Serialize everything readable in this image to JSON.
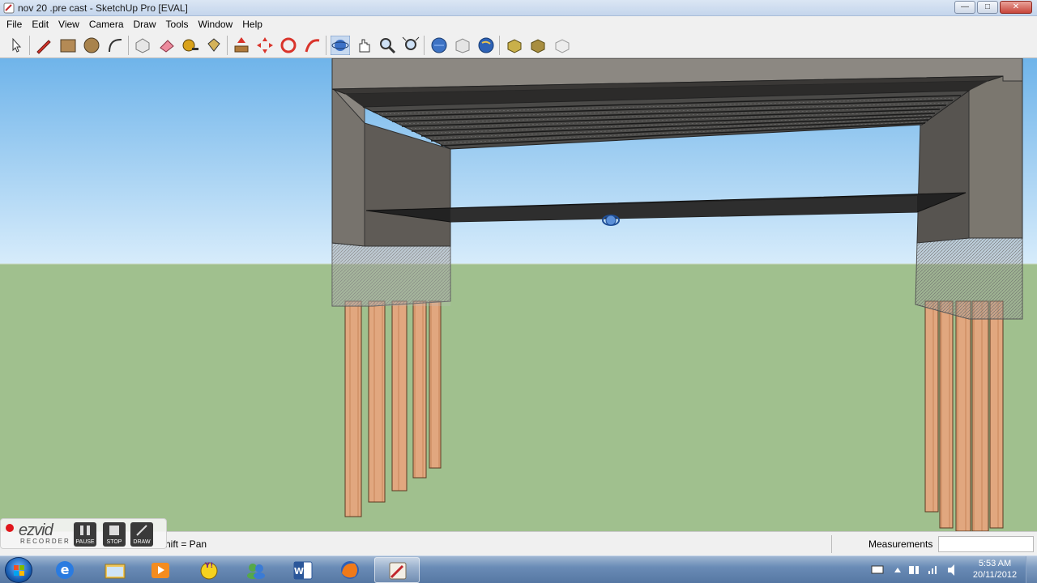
{
  "window": {
    "title": "nov 20 .pre cast - SketchUp Pro [EVAL]",
    "minimize_glyph": "—",
    "maximize_glyph": "□",
    "close_glyph": "✕"
  },
  "menu": {
    "items": [
      "File",
      "Edit",
      "View",
      "Camera",
      "Draw",
      "Tools",
      "Window",
      "Help"
    ]
  },
  "toolbar": {
    "tools": [
      "select-icon",
      "pencil-icon",
      "rectangle-icon",
      "circle-icon",
      "arc-icon",
      "make-component-icon",
      "eraser-icon",
      "tape-measure-icon",
      "paint-bucket-icon",
      "push-pull-icon",
      "move-icon",
      "rotate-icon",
      "follow-me-icon",
      "orbit-icon",
      "pan-icon",
      "zoom-icon",
      "zoom-extents-icon",
      "get-models-icon",
      "share-model-icon",
      "google-earth-icon",
      "component-download-icon",
      "component-share-icon",
      "extension-icon"
    ]
  },
  "status": {
    "hint": "hift = Pan",
    "measurements_label": "Measurements",
    "measurements_value": ""
  },
  "ezvid": {
    "logo": "ezvid",
    "sub": "RECORDER",
    "pause_label": "PAUSE",
    "stop_label": "STOP",
    "draw_label": "DRAW"
  },
  "taskbar": {
    "apps": [
      "ie-icon",
      "explorer-icon",
      "media-player-icon",
      "yahoo-messenger-icon",
      "windows-live-messenger-icon",
      "word-icon",
      "firefox-icon",
      "sketchup-icon"
    ],
    "active_app": "sketchup-icon",
    "clock_time": "5:53 AM",
    "clock_date": "20/11/2012"
  },
  "colors": {
    "sky": "#80bff0",
    "ground": "#a0c08e",
    "concrete": "#6f6a63",
    "pile": "#e1a77f"
  }
}
